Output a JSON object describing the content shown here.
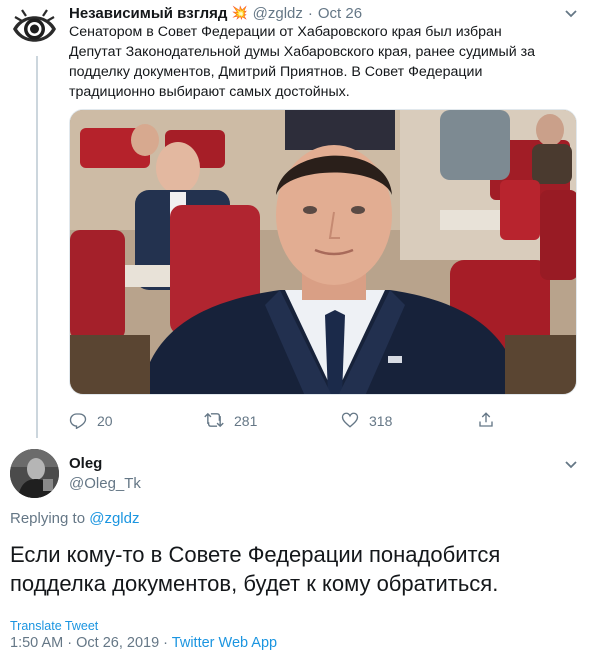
{
  "parent_tweet": {
    "display_name": "Независимый взгляд",
    "emoji": "💥",
    "handle": "@zgldz",
    "separator": "·",
    "date": "Oct 26",
    "text_lines": [
      "Сенатором в Совет Федерации от Хабаровского края был избран",
      "Депутат Законодательной думы Хабаровского края, ранее судимый за",
      "подделку документов,  Дмитрий Приятнов. В Совет Федерации",
      "традиционно выбирают самых достойных."
    ],
    "stats": {
      "replies": "20",
      "retweets": "281",
      "likes": "318"
    },
    "icons": {
      "avatar": "eye-icon",
      "menu": "chevron-down-icon",
      "reply": "reply-icon",
      "retweet": "retweet-icon",
      "like": "heart-icon",
      "share": "share-icon"
    }
  },
  "reply_tweet": {
    "display_name": "Oleg",
    "handle": "@Oleg_Tk",
    "replying_prefix": "Replying to",
    "replying_to": "@zgldz",
    "text_lines": [
      "Если кому-то в Совете Федерации понадобится",
      "подделка документов, будет к кому обратиться."
    ],
    "translate_label": "Translate Tweet",
    "time": "1:50 AM",
    "separator": "·",
    "date": "Oct 26, 2019",
    "source": "Twitter Web App"
  },
  "colors": {
    "text": "#14171a",
    "muted": "#657786",
    "link": "#1b95e0",
    "border": "#ccd6dd"
  }
}
